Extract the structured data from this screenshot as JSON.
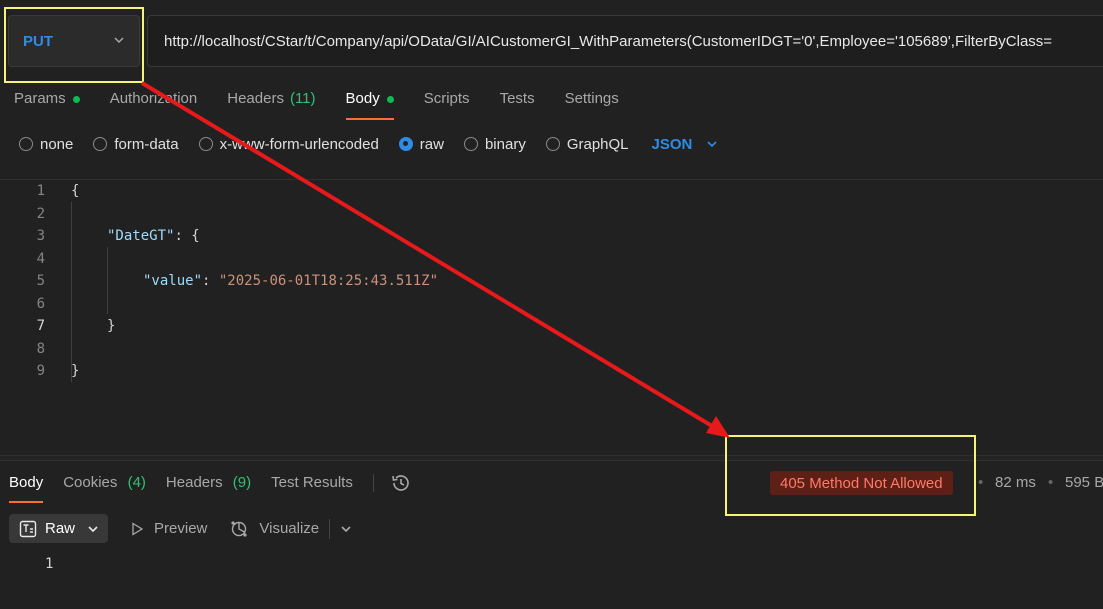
{
  "request": {
    "method": "PUT",
    "url": "http://localhost/CStar/t/Company/api/OData/GI/AICustomerGI_WithParameters(CustomerIDGT='0',Employee='105689',FilterByClass="
  },
  "request_tabs": {
    "params": "Params",
    "authorization": "Authorization",
    "headers": "Headers",
    "headers_count": "(11)",
    "body": "Body",
    "scripts": "Scripts",
    "tests": "Tests",
    "settings": "Settings"
  },
  "body_types": {
    "none": "none",
    "form_data": "form-data",
    "urlencoded": "x-www-form-urlencoded",
    "raw": "raw",
    "binary": "binary",
    "graphql": "GraphQL",
    "selected": "raw",
    "language": "JSON"
  },
  "editor": {
    "line_numbers": [
      "1",
      "2",
      "3",
      "4",
      "5",
      "6",
      "7",
      "8",
      "9"
    ],
    "open_brace": "{",
    "dategt_key": "\"DateGT\"",
    "colon": ": ",
    "value_key": "\"value\"",
    "value_str": "\"2025-06-01T18:25:43.511Z\"",
    "close_brace": "}"
  },
  "response_tabs": {
    "body": "Body",
    "cookies": "Cookies",
    "cookies_count": "(4)",
    "headers": "Headers",
    "headers_count": "(9)",
    "test_results": "Test Results"
  },
  "response_status": {
    "status": "405 Method Not Allowed",
    "time": "82 ms",
    "size": "595 B",
    "bullet": "•"
  },
  "response_tools": {
    "raw": "Raw",
    "preview": "Preview",
    "visualize": "Visualize"
  },
  "response_body": {
    "line_number": "1"
  },
  "colors": {
    "annotation_box": "#f6f37a",
    "annotation_arrow": "#e8191b",
    "accent_tab": "#ff6c37",
    "method_blue": "#2e8be6",
    "status_error": "#ff7a66"
  }
}
